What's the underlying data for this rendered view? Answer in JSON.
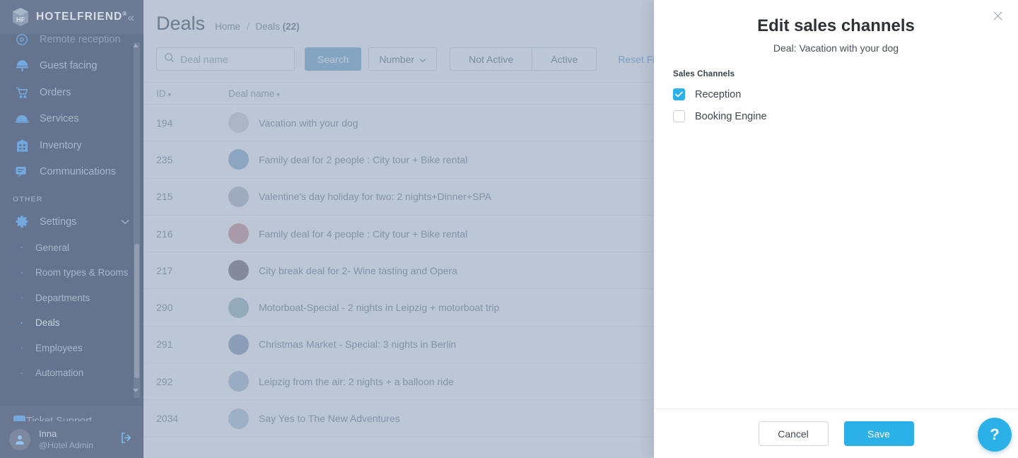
{
  "sidebar": {
    "brand": "HOTELFRIEND",
    "brand_reg": "®",
    "collapse_icon": "chevron-double-left-icon",
    "nav_items": [
      {
        "label": "Remote reception",
        "icon": "gear-circle-icon"
      },
      {
        "label": "Guest facing",
        "icon": "concierge-icon"
      },
      {
        "label": "Orders",
        "icon": "cart-icon"
      },
      {
        "label": "Services",
        "icon": "cloche-icon"
      },
      {
        "label": "Inventory",
        "icon": "building-icon"
      },
      {
        "label": "Communications",
        "icon": "chat-icon"
      }
    ],
    "section_label": "OTHER",
    "settings": {
      "label": "Settings",
      "icon": "gear-icon",
      "chevron": "chevron-down-icon"
    },
    "sub_items": [
      {
        "label": "General",
        "active": false
      },
      {
        "label": "Room types & Rooms",
        "active": false
      },
      {
        "label": "Departments",
        "active": false
      },
      {
        "label": "Deals",
        "active": true
      },
      {
        "label": "Employees",
        "active": false
      },
      {
        "label": "Automation",
        "active": false
      }
    ],
    "ticket_support": {
      "label": "Ticket Support",
      "icon": "ticket-icon"
    },
    "user": {
      "name": "Inna",
      "role": "@Hotel Admin",
      "logout_icon": "logout-icon",
      "avatar_icon": "user-avatar-icon"
    }
  },
  "header": {
    "title": "Deals",
    "breadcrumb_home": "Home",
    "breadcrumb_sep": "/",
    "breadcrumb_current": "Deals",
    "breadcrumb_count": "(22)"
  },
  "toolbar": {
    "search_placeholder": "Deal name",
    "search_value": "",
    "search_icon": "search-icon",
    "search_button": "Search",
    "number_button": "Number",
    "number_chevron": "chevron-down-icon",
    "seg_not_active": "Not Active",
    "seg_active": "Active",
    "reset_filters": "Reset Filters"
  },
  "table": {
    "columns": [
      "ID",
      "Deal name"
    ],
    "rows": [
      {
        "id": "194",
        "name": "Vacation with your dog"
      },
      {
        "id": "235",
        "name": "Family deal for 2 people : City tour + Bike rental"
      },
      {
        "id": "215",
        "name": "Valentine's day holiday for two: 2 nights+Dinner+SPA"
      },
      {
        "id": "216",
        "name": "Family deal for 4 people : City tour + Bike rental"
      },
      {
        "id": "217",
        "name": "City break deal for 2- Wine tasting and Opera"
      },
      {
        "id": "290",
        "name": "Motorboat-Special - 2 nights in Leipzig + motorboat trip"
      },
      {
        "id": "291",
        "name": "Christmas Market - Special: 3 nights in Berlin"
      },
      {
        "id": "292",
        "name": "Leipzig from the air: 2 nights + a balloon ride"
      },
      {
        "id": "2034",
        "name": "Say Yes to The New Adventures"
      }
    ]
  },
  "panel": {
    "title": "Edit sales channels",
    "subtitle": "Deal: Vacation with your dog",
    "close_icon": "close-icon",
    "field_label": "Sales Channels",
    "channels": [
      {
        "label": "Reception",
        "checked": true
      },
      {
        "label": "Booking Engine",
        "checked": false
      }
    ],
    "cancel_label": "Cancel",
    "save_label": "Save"
  },
  "help": {
    "label": "?",
    "icon": "help-icon"
  },
  "colors": {
    "sidebar": "#64748f",
    "accent": "#2cb0e8",
    "link": "#5d93cc",
    "search_btn": "#6fa6ca"
  }
}
